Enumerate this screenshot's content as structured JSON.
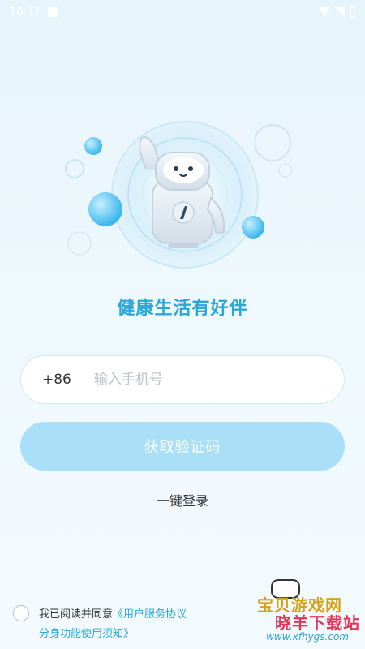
{
  "status_bar": {
    "time": "10:37"
  },
  "tagline": "健康生活有好伴",
  "phone": {
    "country_code": "+86",
    "placeholder": "输入手机号"
  },
  "buttons": {
    "get_code": "获取验证码",
    "one_key_login": "一键登录"
  },
  "agreement": {
    "prefix": "我已阅读并同意",
    "link1": "《用户服务协议",
    "line2": "分身功能使用须知》"
  },
  "watermark": {
    "line1": "宝贝游戏网",
    "line2": "晓羊下载站",
    "line3": "www.xfhygs.com"
  },
  "colors": {
    "accent": "#2ba7d8",
    "button_bg": "#a9e0f7",
    "bg_top": "#e6f4fc"
  }
}
